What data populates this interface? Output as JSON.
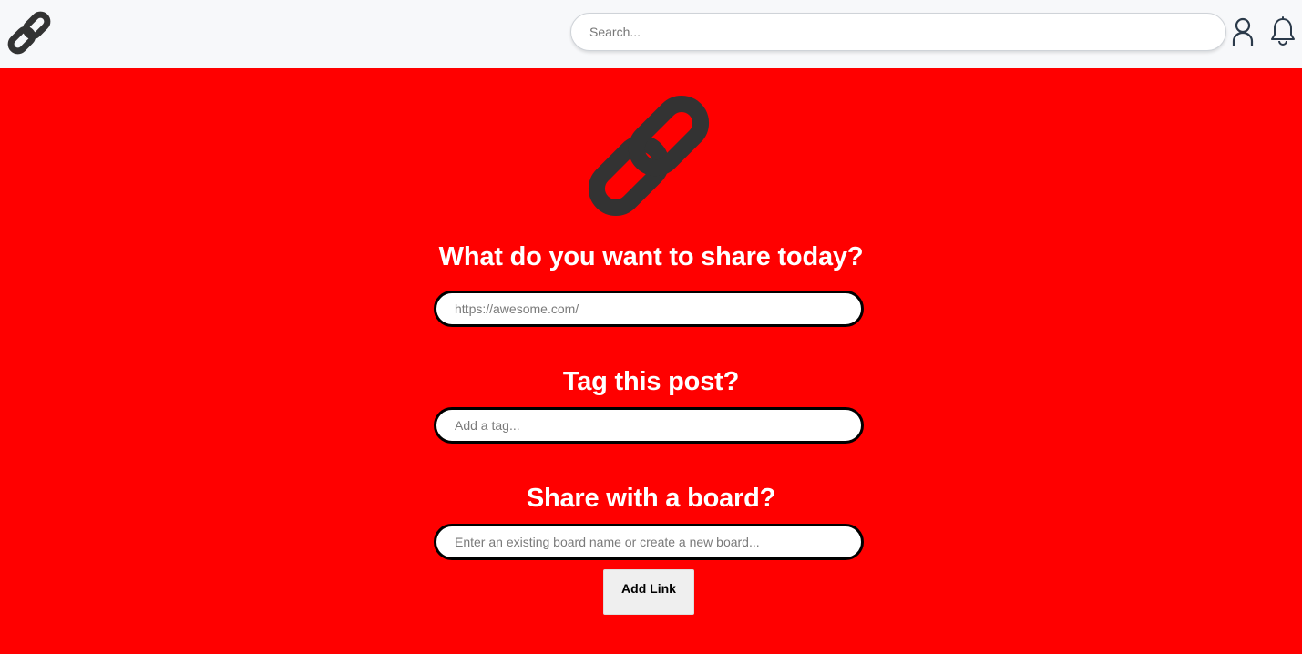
{
  "header": {
    "logo_icon": "link-icon",
    "search": {
      "placeholder": "Search...",
      "value": ""
    },
    "user_icon": "user-icon",
    "bell_icon": "bell-icon"
  },
  "main": {
    "background_color": "#ff0000",
    "hero_icon": "link-icon",
    "url_section": {
      "heading": "What do you want to share today?",
      "placeholder": "https://awesome.com/",
      "value": ""
    },
    "tag_section": {
      "heading": "Tag this post?",
      "placeholder": "Add a tag...",
      "value": ""
    },
    "board_section": {
      "heading": "Share with a board?",
      "placeholder": "Enter an existing board name or create a new board...",
      "value": ""
    },
    "submit_label": "Add Link"
  }
}
